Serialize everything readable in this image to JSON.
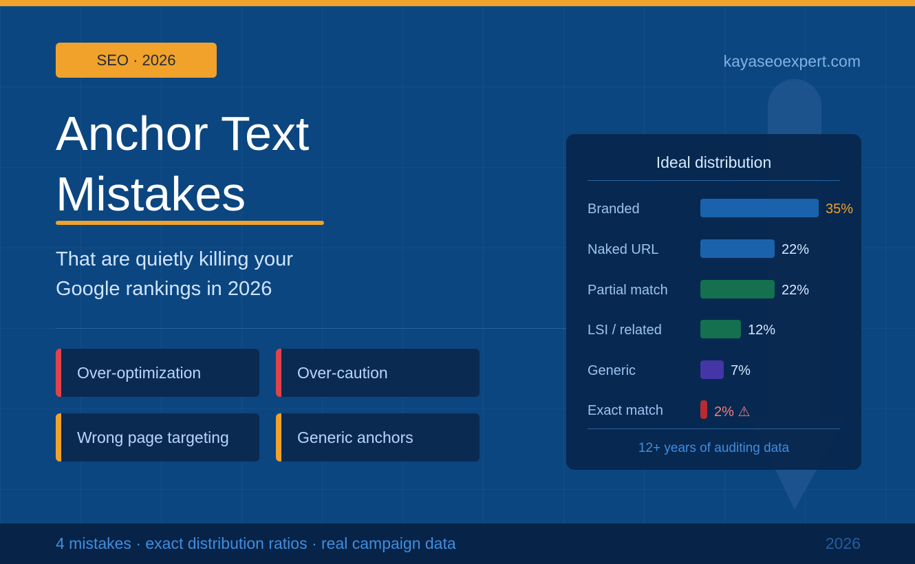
{
  "badge": "SEO · 2026",
  "site": "kayaseoexpert.com",
  "title": {
    "line1": "Anchor Text",
    "line2": "Mistakes"
  },
  "subtitle": {
    "line1": "That are quietly killing your",
    "line2": "Google rankings in 2026"
  },
  "mistakes": [
    {
      "label": "Over-optimization",
      "accent": "#e0434a"
    },
    {
      "label": "Over-caution",
      "accent": "#e0434a"
    },
    {
      "label": "Wrong page targeting",
      "accent": "#f0a22b"
    },
    {
      "label": "Generic anchors",
      "accent": "#f0a22b"
    }
  ],
  "panel": {
    "title": "Ideal distribution",
    "footer": "12+ years of auditing data",
    "rows": [
      {
        "label": "Branded",
        "value": 35,
        "pct": "35%",
        "color": "#1b62ad"
      },
      {
        "label": "Naked URL",
        "value": 22,
        "pct": "22%",
        "color": "#1b62ad"
      },
      {
        "label": "Partial match",
        "value": 22,
        "pct": "22%",
        "color": "#14704f"
      },
      {
        "label": "LSI / related",
        "value": 12,
        "pct": "12%",
        "color": "#14704f"
      },
      {
        "label": "Generic",
        "value": 7,
        "pct": "7%",
        "color": "#4536a8"
      },
      {
        "label": "Exact match",
        "value": 2,
        "pct": "2% ⚠",
        "color": "#b82c31"
      }
    ]
  },
  "footer": {
    "text": "4 mistakes · exact distribution ratios · real campaign data",
    "year": "2026"
  },
  "colors": {
    "background": "#0c4680",
    "accent": "#f0a22b",
    "panel": "#08264c"
  },
  "icons": [
    "warning-icon",
    "down-arrow-icon"
  ]
}
